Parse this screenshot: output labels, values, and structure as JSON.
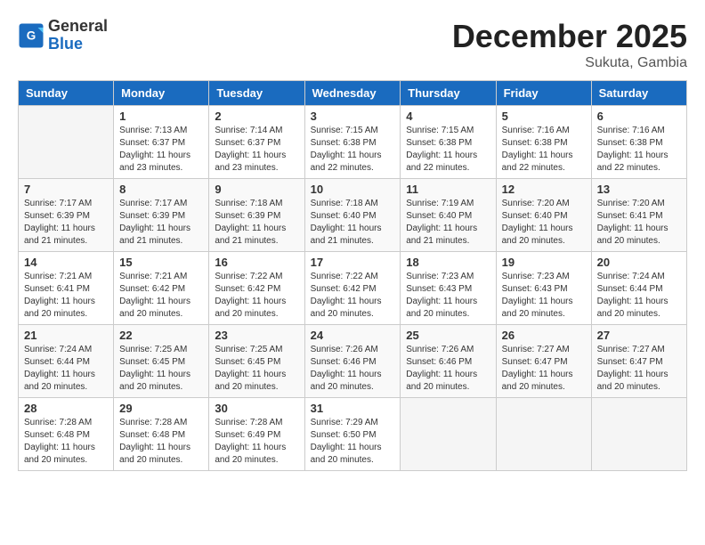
{
  "header": {
    "logo_general": "General",
    "logo_blue": "Blue",
    "month_title": "December 2025",
    "location": "Sukuta, Gambia"
  },
  "days_of_week": [
    "Sunday",
    "Monday",
    "Tuesday",
    "Wednesday",
    "Thursday",
    "Friday",
    "Saturday"
  ],
  "weeks": [
    [
      {
        "day": "",
        "sunrise": "",
        "sunset": "",
        "daylight": ""
      },
      {
        "day": "1",
        "sunrise": "Sunrise: 7:13 AM",
        "sunset": "Sunset: 6:37 PM",
        "daylight": "Daylight: 11 hours and 23 minutes."
      },
      {
        "day": "2",
        "sunrise": "Sunrise: 7:14 AM",
        "sunset": "Sunset: 6:37 PM",
        "daylight": "Daylight: 11 hours and 23 minutes."
      },
      {
        "day": "3",
        "sunrise": "Sunrise: 7:15 AM",
        "sunset": "Sunset: 6:38 PM",
        "daylight": "Daylight: 11 hours and 22 minutes."
      },
      {
        "day": "4",
        "sunrise": "Sunrise: 7:15 AM",
        "sunset": "Sunset: 6:38 PM",
        "daylight": "Daylight: 11 hours and 22 minutes."
      },
      {
        "day": "5",
        "sunrise": "Sunrise: 7:16 AM",
        "sunset": "Sunset: 6:38 PM",
        "daylight": "Daylight: 11 hours and 22 minutes."
      },
      {
        "day": "6",
        "sunrise": "Sunrise: 7:16 AM",
        "sunset": "Sunset: 6:38 PM",
        "daylight": "Daylight: 11 hours and 22 minutes."
      }
    ],
    [
      {
        "day": "7",
        "sunrise": "Sunrise: 7:17 AM",
        "sunset": "Sunset: 6:39 PM",
        "daylight": "Daylight: 11 hours and 21 minutes."
      },
      {
        "day": "8",
        "sunrise": "Sunrise: 7:17 AM",
        "sunset": "Sunset: 6:39 PM",
        "daylight": "Daylight: 11 hours and 21 minutes."
      },
      {
        "day": "9",
        "sunrise": "Sunrise: 7:18 AM",
        "sunset": "Sunset: 6:39 PM",
        "daylight": "Daylight: 11 hours and 21 minutes."
      },
      {
        "day": "10",
        "sunrise": "Sunrise: 7:18 AM",
        "sunset": "Sunset: 6:40 PM",
        "daylight": "Daylight: 11 hours and 21 minutes."
      },
      {
        "day": "11",
        "sunrise": "Sunrise: 7:19 AM",
        "sunset": "Sunset: 6:40 PM",
        "daylight": "Daylight: 11 hours and 21 minutes."
      },
      {
        "day": "12",
        "sunrise": "Sunrise: 7:20 AM",
        "sunset": "Sunset: 6:40 PM",
        "daylight": "Daylight: 11 hours and 20 minutes."
      },
      {
        "day": "13",
        "sunrise": "Sunrise: 7:20 AM",
        "sunset": "Sunset: 6:41 PM",
        "daylight": "Daylight: 11 hours and 20 minutes."
      }
    ],
    [
      {
        "day": "14",
        "sunrise": "Sunrise: 7:21 AM",
        "sunset": "Sunset: 6:41 PM",
        "daylight": "Daylight: 11 hours and 20 minutes."
      },
      {
        "day": "15",
        "sunrise": "Sunrise: 7:21 AM",
        "sunset": "Sunset: 6:42 PM",
        "daylight": "Daylight: 11 hours and 20 minutes."
      },
      {
        "day": "16",
        "sunrise": "Sunrise: 7:22 AM",
        "sunset": "Sunset: 6:42 PM",
        "daylight": "Daylight: 11 hours and 20 minutes."
      },
      {
        "day": "17",
        "sunrise": "Sunrise: 7:22 AM",
        "sunset": "Sunset: 6:42 PM",
        "daylight": "Daylight: 11 hours and 20 minutes."
      },
      {
        "day": "18",
        "sunrise": "Sunrise: 7:23 AM",
        "sunset": "Sunset: 6:43 PM",
        "daylight": "Daylight: 11 hours and 20 minutes."
      },
      {
        "day": "19",
        "sunrise": "Sunrise: 7:23 AM",
        "sunset": "Sunset: 6:43 PM",
        "daylight": "Daylight: 11 hours and 20 minutes."
      },
      {
        "day": "20",
        "sunrise": "Sunrise: 7:24 AM",
        "sunset": "Sunset: 6:44 PM",
        "daylight": "Daylight: 11 hours and 20 minutes."
      }
    ],
    [
      {
        "day": "21",
        "sunrise": "Sunrise: 7:24 AM",
        "sunset": "Sunset: 6:44 PM",
        "daylight": "Daylight: 11 hours and 20 minutes."
      },
      {
        "day": "22",
        "sunrise": "Sunrise: 7:25 AM",
        "sunset": "Sunset: 6:45 PM",
        "daylight": "Daylight: 11 hours and 20 minutes."
      },
      {
        "day": "23",
        "sunrise": "Sunrise: 7:25 AM",
        "sunset": "Sunset: 6:45 PM",
        "daylight": "Daylight: 11 hours and 20 minutes."
      },
      {
        "day": "24",
        "sunrise": "Sunrise: 7:26 AM",
        "sunset": "Sunset: 6:46 PM",
        "daylight": "Daylight: 11 hours and 20 minutes."
      },
      {
        "day": "25",
        "sunrise": "Sunrise: 7:26 AM",
        "sunset": "Sunset: 6:46 PM",
        "daylight": "Daylight: 11 hours and 20 minutes."
      },
      {
        "day": "26",
        "sunrise": "Sunrise: 7:27 AM",
        "sunset": "Sunset: 6:47 PM",
        "daylight": "Daylight: 11 hours and 20 minutes."
      },
      {
        "day": "27",
        "sunrise": "Sunrise: 7:27 AM",
        "sunset": "Sunset: 6:47 PM",
        "daylight": "Daylight: 11 hours and 20 minutes."
      }
    ],
    [
      {
        "day": "28",
        "sunrise": "Sunrise: 7:28 AM",
        "sunset": "Sunset: 6:48 PM",
        "daylight": "Daylight: 11 hours and 20 minutes."
      },
      {
        "day": "29",
        "sunrise": "Sunrise: 7:28 AM",
        "sunset": "Sunset: 6:48 PM",
        "daylight": "Daylight: 11 hours and 20 minutes."
      },
      {
        "day": "30",
        "sunrise": "Sunrise: 7:28 AM",
        "sunset": "Sunset: 6:49 PM",
        "daylight": "Daylight: 11 hours and 20 minutes."
      },
      {
        "day": "31",
        "sunrise": "Sunrise: 7:29 AM",
        "sunset": "Sunset: 6:50 PM",
        "daylight": "Daylight: 11 hours and 20 minutes."
      },
      {
        "day": "",
        "sunrise": "",
        "sunset": "",
        "daylight": ""
      },
      {
        "day": "",
        "sunrise": "",
        "sunset": "",
        "daylight": ""
      },
      {
        "day": "",
        "sunrise": "",
        "sunset": "",
        "daylight": ""
      }
    ]
  ]
}
